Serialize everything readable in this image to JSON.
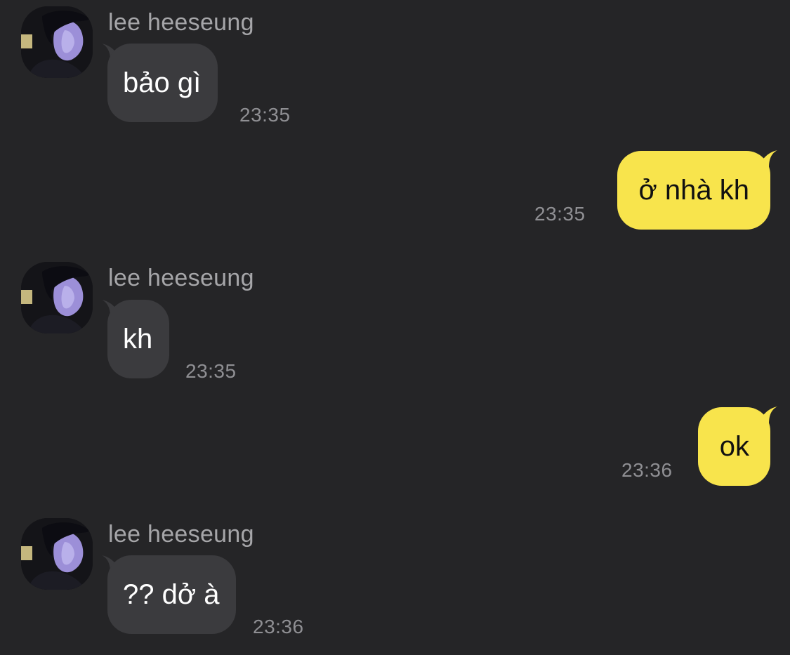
{
  "chat": {
    "colors": {
      "background": "#252527",
      "incoming_bubble": "#3b3b3e",
      "outgoing_bubble": "#f8e44c",
      "timestamp": "#8f8f93",
      "sender_name": "#a6a6a9"
    },
    "messages": [
      {
        "direction": "incoming",
        "sender": "lee heeseung",
        "text": "bảo gì",
        "time": "23:35"
      },
      {
        "direction": "outgoing",
        "text": "ở nhà kh",
        "time": "23:35"
      },
      {
        "direction": "incoming",
        "sender": "lee heeseung",
        "text": "kh",
        "time": "23:35"
      },
      {
        "direction": "outgoing",
        "text": "ok",
        "time": "23:36"
      },
      {
        "direction": "incoming",
        "sender": "lee heeseung",
        "text": "?? dở à",
        "time": "23:36"
      }
    ]
  }
}
